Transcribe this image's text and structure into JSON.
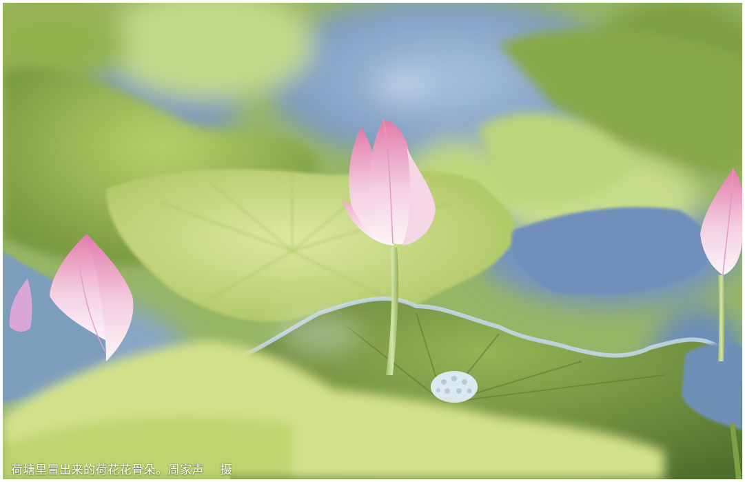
{
  "photo": {
    "subject": "lotus-pond",
    "colors": {
      "leaf_light": "#c9da7a",
      "leaf_mid": "#9fbf52",
      "leaf_dark": "#6f8f3a",
      "leaf_blue": "#6f8fb6",
      "water_blue": "#8aa9cf",
      "petal_pink": "#e58fb4",
      "petal_white": "#f7eef3",
      "stem": "#b9cf86"
    }
  },
  "caption": {
    "text": "荷塘里冒出来的荷花花骨朵。周家声    摄"
  }
}
